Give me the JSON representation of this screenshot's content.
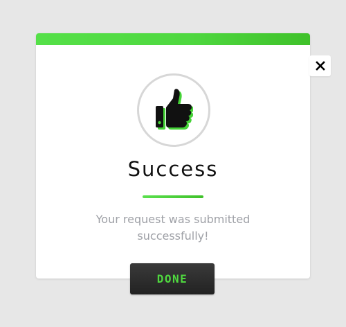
{
  "dialog": {
    "title": "Success",
    "message": "Your request was submitted successfully!",
    "icon": "thumbs-up-icon",
    "done_label": "DONE",
    "close_icon": "close-icon"
  },
  "colors": {
    "accent": "#4fd840",
    "accent_dark": "#3fc12a",
    "button_bg": "#2b2b2b",
    "message_text": "#9ea0a6",
    "backdrop": "#e7e7e7"
  }
}
